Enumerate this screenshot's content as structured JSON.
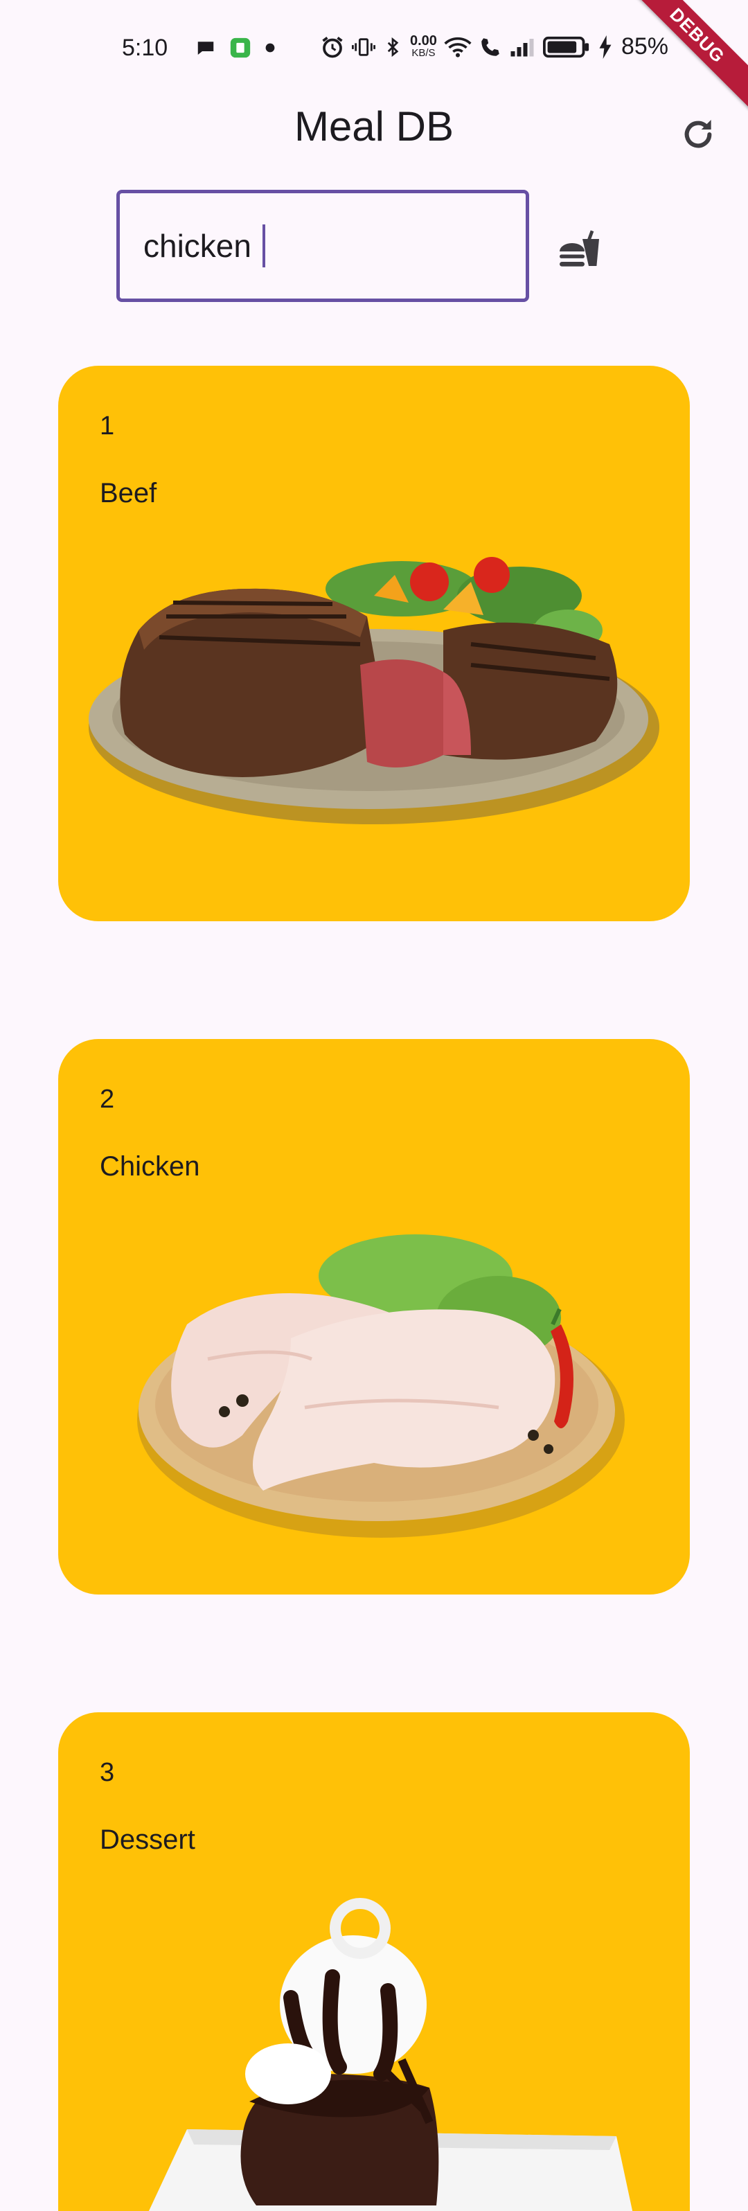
{
  "status_bar": {
    "time": "5:10",
    "net_speed_value": "0.00",
    "net_speed_unit": "KB/S",
    "battery_percent": "85%",
    "debug_banner": "DEBUG"
  },
  "app_bar": {
    "title": "Meal DB",
    "refresh_icon": "refresh-icon"
  },
  "search": {
    "value": "chicken",
    "search_icon": "fastfood-icon"
  },
  "categories": [
    {
      "index": "1",
      "name": "Beef",
      "image": "beef-steak-plate"
    },
    {
      "index": "2",
      "name": "Chicken",
      "image": "raw-chicken-legs-board"
    },
    {
      "index": "3",
      "name": "Dessert",
      "image": "chocolate-lava-cake"
    }
  ],
  "colors": {
    "background": "#fdf7fd",
    "card": "#ffc107",
    "accent": "#6750a4",
    "debug": "#b71c3a"
  }
}
